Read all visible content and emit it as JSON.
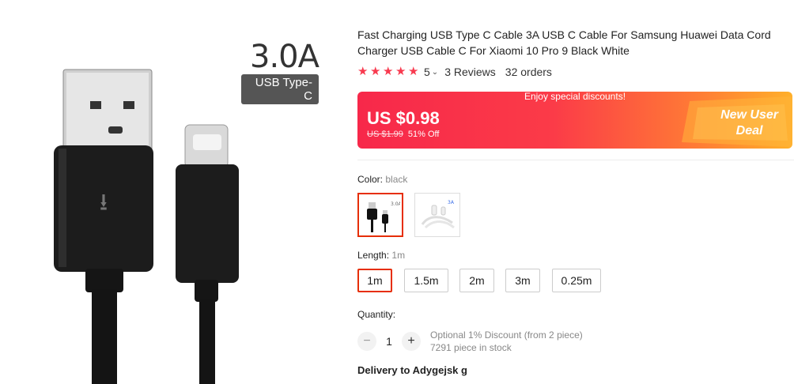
{
  "image": {
    "badge_big": "3.0A",
    "badge_small": "USB Type-C"
  },
  "product": {
    "title": "Fast Charging USB Type C Cable 3A USB C Cable For Samsung Huawei Data Cord Charger USB Cable C For Xiaomi 10 Pro 9 Black White",
    "rating": "5",
    "reviews": "3 Reviews",
    "orders": "32 orders"
  },
  "price": {
    "promo": "Enjoy special discounts!",
    "current": "US $0.98",
    "original": "US $1.99",
    "discount": "51% Off",
    "deal_line1": "New User",
    "deal_line2": "Deal"
  },
  "color": {
    "label": "Color:",
    "selected": "black",
    "options": [
      "black",
      "white"
    ]
  },
  "length": {
    "label": "Length:",
    "selected": "1m",
    "options": [
      "1m",
      "1.5m",
      "2m",
      "3m",
      "0.25m"
    ]
  },
  "quantity": {
    "label": "Quantity:",
    "value": "1",
    "minus": "−",
    "plus": "+",
    "discount_note": "Optional 1% Discount (from 2 piece)",
    "stock": "7291 piece in stock"
  },
  "delivery": {
    "text": "Delivery to Adygejsk g"
  },
  "colors": {
    "accent": "#e62e04",
    "star": "#f83a4f"
  }
}
